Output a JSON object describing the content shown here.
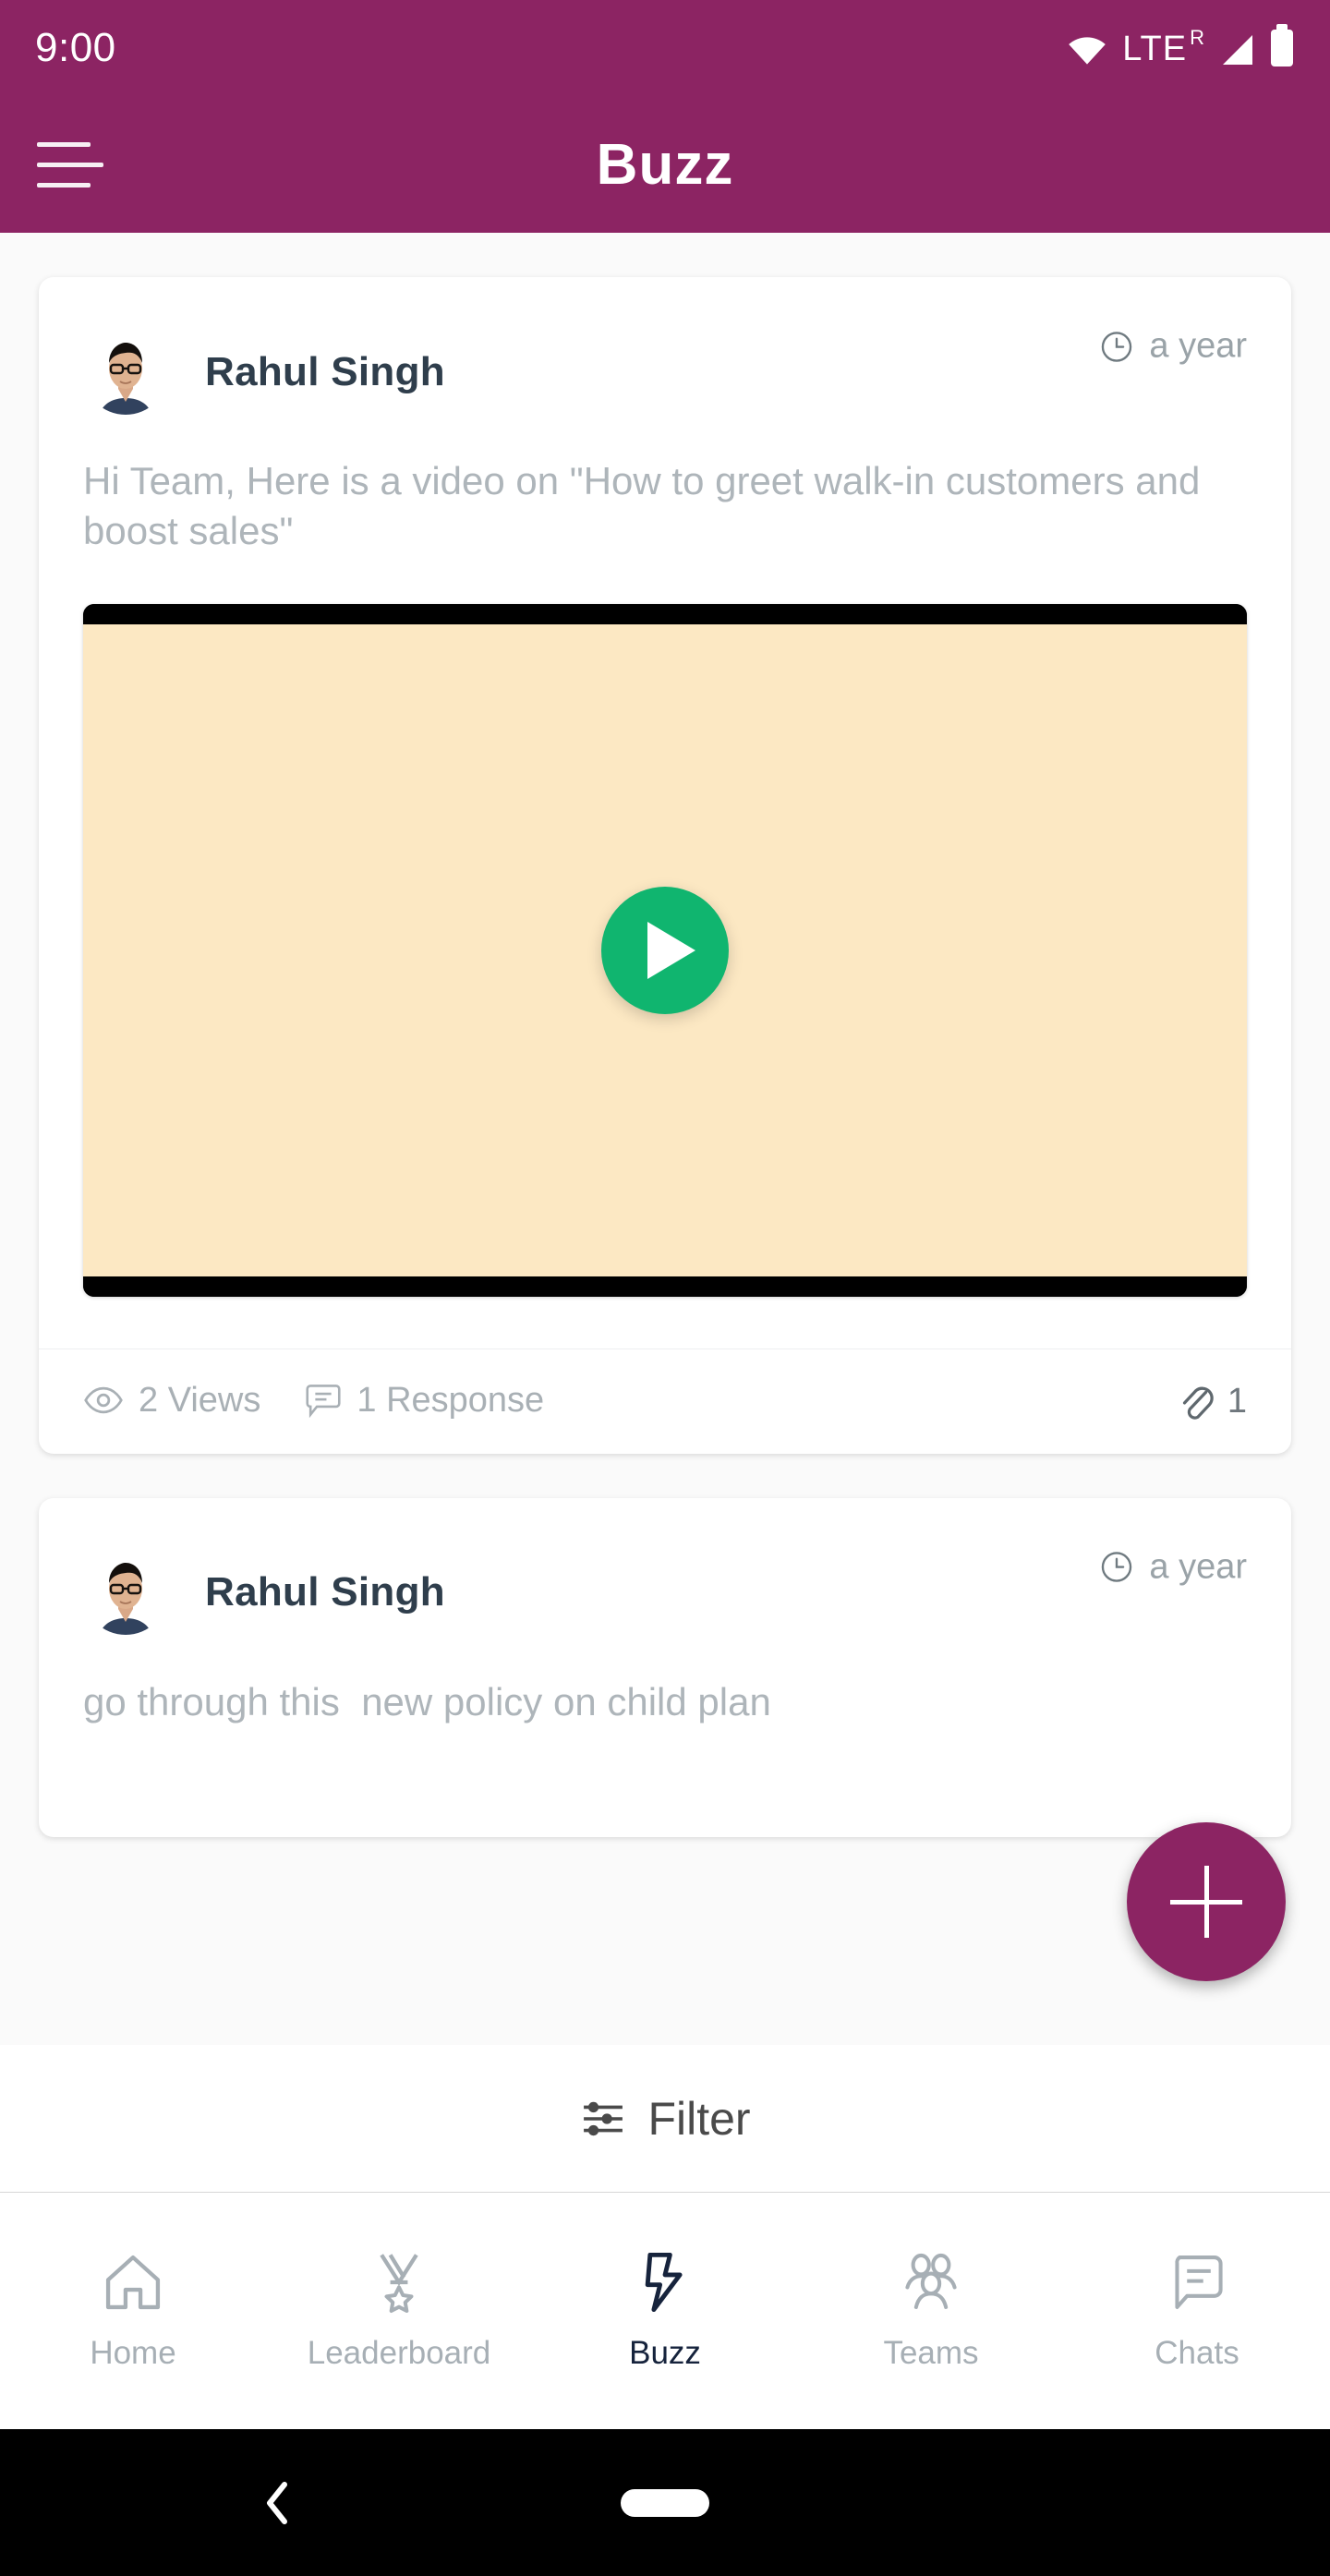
{
  "status_bar": {
    "time": "9:00",
    "network_label": "LTE",
    "roaming_indicator": "R",
    "icons": [
      "wifi-icon",
      "signal-icon",
      "battery-icon"
    ]
  },
  "app_bar": {
    "title": "Buzz",
    "menu_icon": "hamburger-menu-icon",
    "background_color": "#8C2463"
  },
  "feed": {
    "posts": [
      {
        "author": "Rahul Singh",
        "time": "a year",
        "time_icon": "clock-icon",
        "text": "Hi Team, Here is a video on \"How to greet walk-in customers and boost sales\"",
        "media": {
          "type": "video",
          "play_icon": "play-icon",
          "play_button_color": "#10B56F",
          "thumbnail_color": "#FCE8C3",
          "letterbox_color": "#000000"
        },
        "stats": {
          "views_icon": "eye-icon",
          "views": "2 Views",
          "responses_icon": "comment-icon",
          "responses": "1 Response",
          "attachment_icon": "paperclip-icon",
          "attachments": "1"
        }
      },
      {
        "author": "Rahul Singh",
        "time": "a year",
        "time_icon": "clock-icon",
        "text": "go through this  new policy on child plan"
      }
    ]
  },
  "fab": {
    "label": "add-post",
    "icon": "plus-icon",
    "color": "#8C2463"
  },
  "filter": {
    "label": "Filter",
    "icon": "tune-icon"
  },
  "bottom_nav": {
    "items": [
      {
        "label": "Home",
        "icon": "home-icon",
        "active": false
      },
      {
        "label": "Leaderboard",
        "icon": "medal-icon",
        "active": false
      },
      {
        "label": "Buzz",
        "icon": "lightning-bolt-icon",
        "active": true
      },
      {
        "label": "Teams",
        "icon": "people-icon",
        "active": false
      },
      {
        "label": "Chats",
        "icon": "chat-bubble-icon",
        "active": false
      }
    ],
    "active_color": "#16233C",
    "inactive_color": "#A7AFB5"
  },
  "android_nav": {
    "back_icon": "back-chevron-icon",
    "home_icon": "home-pill-icon"
  }
}
